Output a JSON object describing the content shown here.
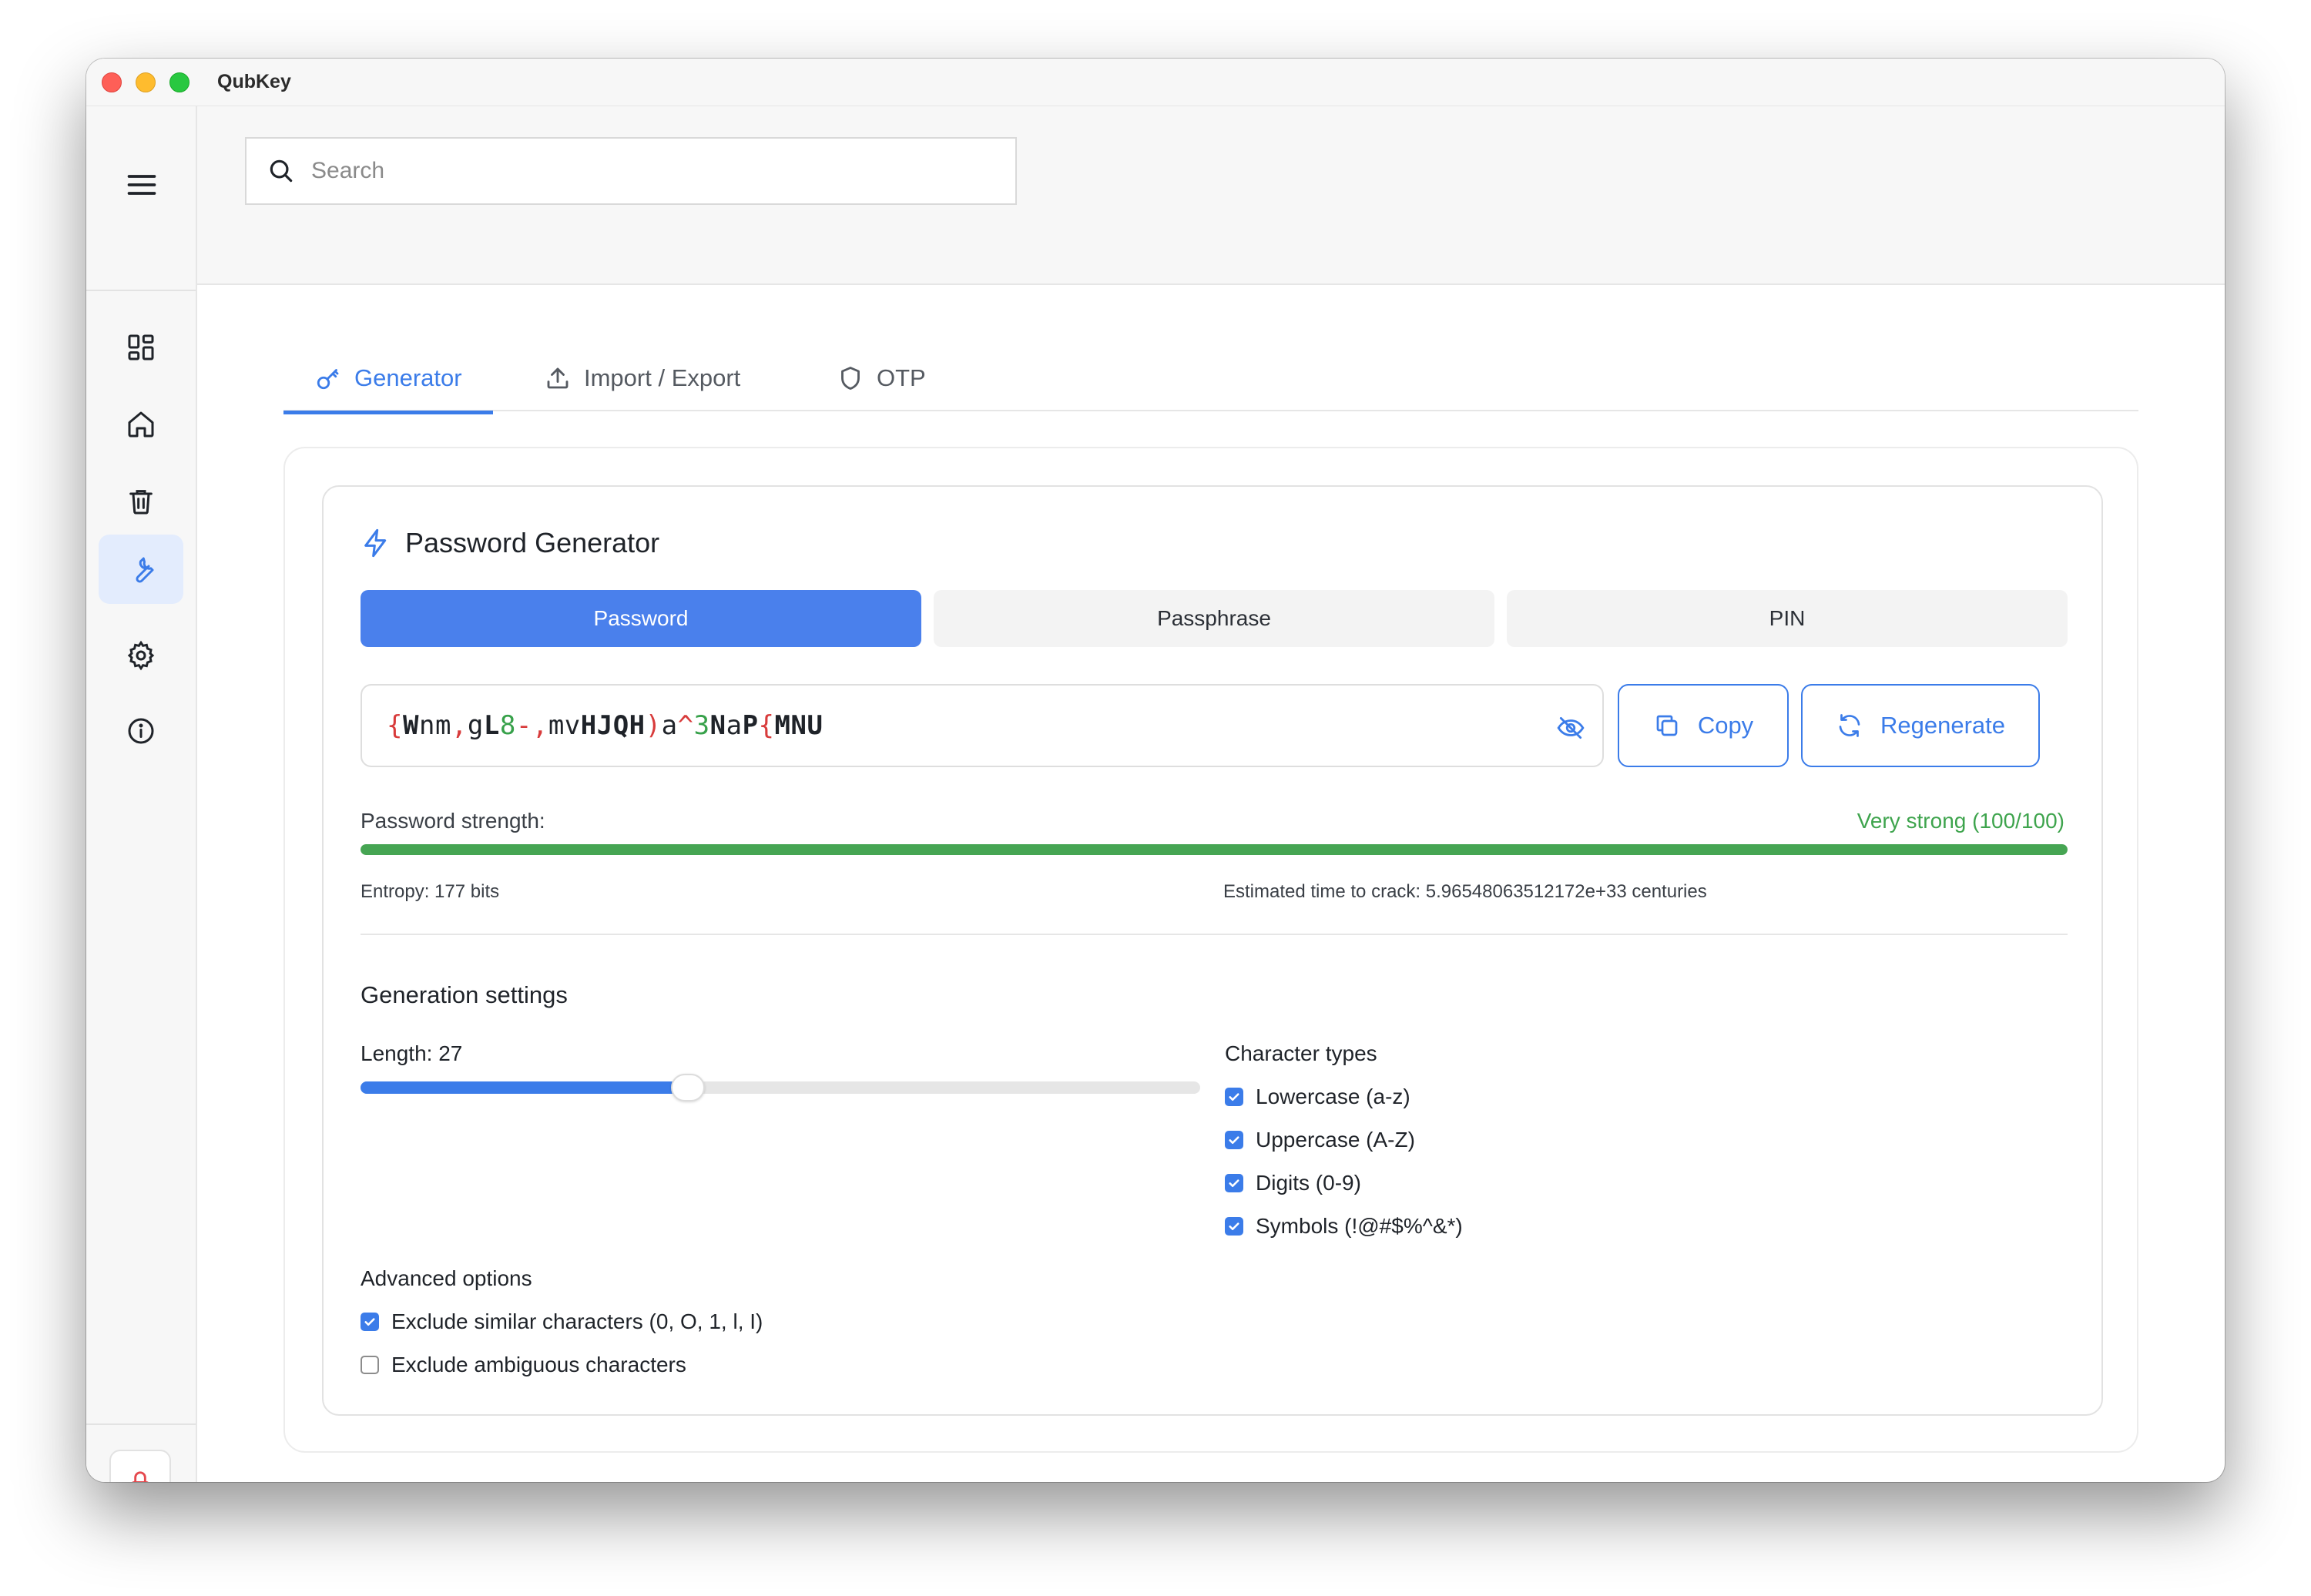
{
  "window": {
    "title": "QubKey"
  },
  "search": {
    "placeholder": "Search"
  },
  "tabs": [
    {
      "label": "Generator",
      "icon": "key-icon",
      "active": true
    },
    {
      "label": "Import / Export",
      "icon": "upload-icon",
      "active": false
    },
    {
      "label": "OTP",
      "icon": "shield-icon",
      "active": false
    }
  ],
  "generator": {
    "title": "Password Generator",
    "modes": [
      {
        "label": "Password",
        "active": true
      },
      {
        "label": "Passphrase",
        "active": false
      },
      {
        "label": "PIN",
        "active": false
      }
    ],
    "password": [
      {
        "t": "{",
        "k": "sym"
      },
      {
        "t": "W",
        "k": "up"
      },
      {
        "t": "nm",
        "k": "low"
      },
      {
        "t": ",",
        "k": "sym"
      },
      {
        "t": "g",
        "k": "low"
      },
      {
        "t": "L",
        "k": "up"
      },
      {
        "t": "8",
        "k": "dig"
      },
      {
        "t": "-,",
        "k": "sym"
      },
      {
        "t": "mv",
        "k": "low"
      },
      {
        "t": "HJQH",
        "k": "up"
      },
      {
        "t": ")",
        "k": "sym"
      },
      {
        "t": "a",
        "k": "low"
      },
      {
        "t": "^",
        "k": "sym"
      },
      {
        "t": "3",
        "k": "dig"
      },
      {
        "t": "N",
        "k": "up"
      },
      {
        "t": "a",
        "k": "low"
      },
      {
        "t": "P",
        "k": "up"
      },
      {
        "t": "{",
        "k": "sym"
      },
      {
        "t": "MNU",
        "k": "up"
      }
    ],
    "copy_label": "Copy",
    "regenerate_label": "Regenerate",
    "strength_label": "Password strength:",
    "strength_value": "Very strong (100/100)",
    "strength_score": 100,
    "entropy": "Entropy: 177 bits",
    "crack_time": "Estimated time to crack: 5.96548063512172e+33 centuries"
  },
  "settings": {
    "title": "Generation settings",
    "length_label": "Length: 27",
    "length_fraction": 0.39,
    "char_types_title": "Character types",
    "char_types": [
      {
        "label": "Lowercase (a-z)",
        "checked": true
      },
      {
        "label": "Uppercase (A-Z)",
        "checked": true
      },
      {
        "label": "Digits (0-9)",
        "checked": true
      },
      {
        "label": "Symbols (!@#$%^&*)",
        "checked": true
      }
    ],
    "advanced_title": "Advanced options",
    "advanced": [
      {
        "label": "Exclude similar characters (0, O, 1, l, I)",
        "checked": true
      },
      {
        "label": "Exclude ambiguous characters",
        "checked": false
      }
    ]
  },
  "colors": {
    "accent": "#3b7ce9",
    "strength": "#46a553",
    "symbol": "#d83b3b",
    "digit": "#37a14a",
    "danger": "#e5484d"
  }
}
